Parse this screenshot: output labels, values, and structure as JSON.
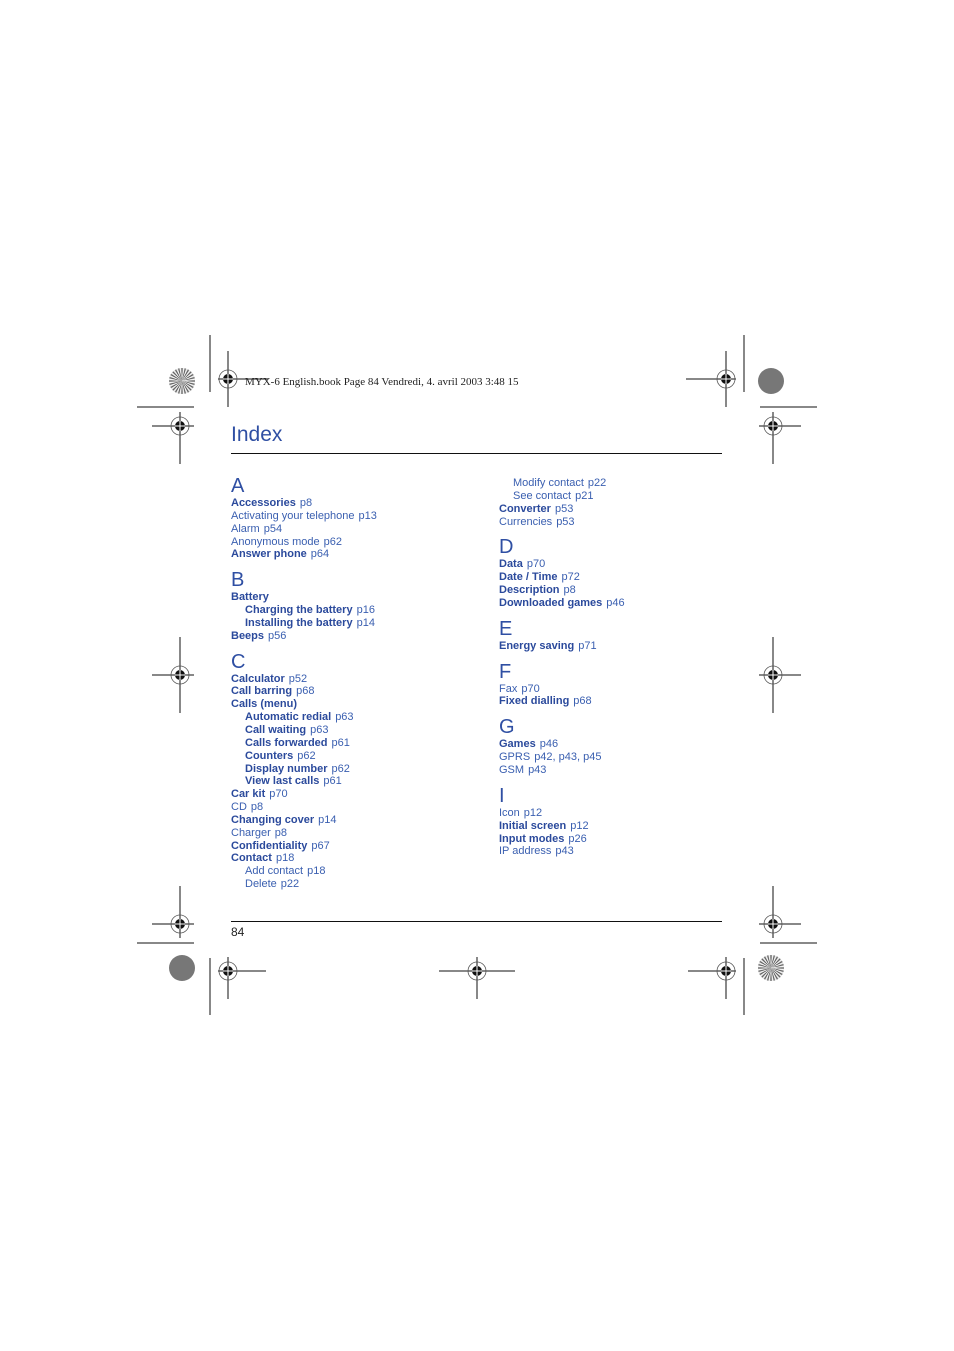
{
  "header": {
    "print_info": "MYX-6 English.book  Page 84  Vendredi, 4. avril 2003  3:48 15"
  },
  "page": {
    "title": "Index",
    "page_number": "84"
  },
  "colors": {
    "text_blue": "#2f4fa3",
    "rule": "#111111"
  },
  "left_column": [
    {
      "letter": "A",
      "entries": [
        {
          "term": "Accessories",
          "page": "p8",
          "bold": true,
          "level": 0
        },
        {
          "term": "Activating your telephone",
          "page": "p13",
          "bold": false,
          "level": 0
        },
        {
          "term": "Alarm",
          "page": "p54",
          "bold": false,
          "level": 0
        },
        {
          "term": "Anonymous mode",
          "page": "p62",
          "bold": false,
          "level": 0
        },
        {
          "term": "Answer phone",
          "page": "p64",
          "bold": true,
          "level": 0
        }
      ]
    },
    {
      "letter": "B",
      "entries": [
        {
          "term": "Battery",
          "page": "",
          "bold": true,
          "level": 0
        },
        {
          "term": "Charging the battery",
          "page": "p16",
          "bold": true,
          "level": 1
        },
        {
          "term": "Installing the battery",
          "page": "p14",
          "bold": true,
          "level": 1
        },
        {
          "term": "Beeps",
          "page": "p56",
          "bold": true,
          "level": 0
        }
      ]
    },
    {
      "letter": "C",
      "entries": [
        {
          "term": "Calculator",
          "page": "p52",
          "bold": true,
          "level": 0
        },
        {
          "term": "Call barring",
          "page": "p68",
          "bold": true,
          "level": 0
        },
        {
          "term": "Calls (menu)",
          "page": "",
          "bold": true,
          "level": 0
        },
        {
          "term": "Automatic redial",
          "page": "p63",
          "bold": true,
          "level": 1
        },
        {
          "term": "Call waiting",
          "page": "p63",
          "bold": true,
          "level": 1
        },
        {
          "term": "Calls forwarded",
          "page": "p61",
          "bold": true,
          "level": 1
        },
        {
          "term": "Counters",
          "page": "p62",
          "bold": true,
          "level": 1
        },
        {
          "term": "Display number",
          "page": "p62",
          "bold": true,
          "level": 1
        },
        {
          "term": "View last calls",
          "page": "p61",
          "bold": true,
          "level": 1
        },
        {
          "term": "Car kit",
          "page": "p70",
          "bold": true,
          "level": 0
        },
        {
          "term": "CD",
          "page": "p8",
          "bold": false,
          "level": 0
        },
        {
          "term": "Changing cover",
          "page": "p14",
          "bold": true,
          "level": 0
        },
        {
          "term": "Charger",
          "page": "p8",
          "bold": false,
          "level": 0
        },
        {
          "term": "Confidentiality",
          "page": "p67",
          "bold": true,
          "level": 0
        },
        {
          "term": "Contact",
          "page": "p18",
          "bold": true,
          "level": 0
        },
        {
          "term": "Add contact",
          "page": "p18",
          "bold": false,
          "level": 1
        },
        {
          "term": "Delete",
          "page": "p22",
          "bold": false,
          "level": 1
        }
      ]
    }
  ],
  "right_column": [
    {
      "letter": "",
      "entries": [
        {
          "term": "Modify contact",
          "page": "p22",
          "bold": false,
          "level": 1
        },
        {
          "term": "See contact",
          "page": "p21",
          "bold": false,
          "level": 1
        },
        {
          "term": "Converter",
          "page": "p53",
          "bold": true,
          "level": 0
        },
        {
          "term": "Currencies",
          "page": "p53",
          "bold": false,
          "level": 0
        }
      ]
    },
    {
      "letter": "D",
      "entries": [
        {
          "term": "Data",
          "page": "p70",
          "bold": true,
          "level": 0
        },
        {
          "term": "Date / Time",
          "page": "p72",
          "bold": true,
          "level": 0
        },
        {
          "term": "Description",
          "page": "p8",
          "bold": true,
          "level": 0
        },
        {
          "term": "Downloaded games",
          "page": "p46",
          "bold": true,
          "level": 0
        }
      ]
    },
    {
      "letter": "E",
      "entries": [
        {
          "term": "Energy saving",
          "page": "p71",
          "bold": true,
          "level": 0
        }
      ]
    },
    {
      "letter": "F",
      "entries": [
        {
          "term": "Fax",
          "page": "p70",
          "bold": false,
          "level": 0
        },
        {
          "term": "Fixed dialling",
          "page": "p68",
          "bold": true,
          "level": 0
        }
      ]
    },
    {
      "letter": "G",
      "entries": [
        {
          "term": "Games",
          "page": "p46",
          "bold": true,
          "level": 0
        },
        {
          "term": "GPRS",
          "page": "p42, p43, p45",
          "bold": false,
          "level": 0
        },
        {
          "term": "GSM",
          "page": "p43",
          "bold": false,
          "level": 0
        }
      ]
    },
    {
      "letter": "I",
      "entries": [
        {
          "term": "Icon",
          "page": "p12",
          "bold": false,
          "level": 0
        },
        {
          "term": "Initial screen",
          "page": "p12",
          "bold": true,
          "level": 0
        },
        {
          "term": "Input modes",
          "page": "p26",
          "bold": true,
          "level": 0
        },
        {
          "term": "IP address",
          "page": "p43",
          "bold": false,
          "level": 0
        }
      ]
    }
  ],
  "print_marks": [
    {
      "type": "registration",
      "name": "registration-mark-top-left"
    },
    {
      "type": "registration",
      "name": "registration-mark-top-right"
    },
    {
      "type": "registration",
      "name": "registration-mark-left-upper"
    },
    {
      "type": "registration",
      "name": "registration-mark-right-upper"
    },
    {
      "type": "registration",
      "name": "registration-mark-left-middle"
    },
    {
      "type": "registration",
      "name": "registration-mark-right-middle"
    },
    {
      "type": "registration",
      "name": "registration-mark-left-lower"
    },
    {
      "type": "registration",
      "name": "registration-mark-right-lower"
    },
    {
      "type": "registration",
      "name": "registration-mark-bottom-left"
    },
    {
      "type": "registration",
      "name": "registration-mark-bottom-center"
    },
    {
      "type": "registration",
      "name": "registration-mark-bottom-right"
    },
    {
      "type": "star-target",
      "name": "star-target-top-left"
    },
    {
      "type": "gray-dot",
      "name": "gray-dot-top-right"
    },
    {
      "type": "gray-dot",
      "name": "gray-dot-bottom-left"
    },
    {
      "type": "star-target",
      "name": "star-target-bottom-right"
    }
  ]
}
